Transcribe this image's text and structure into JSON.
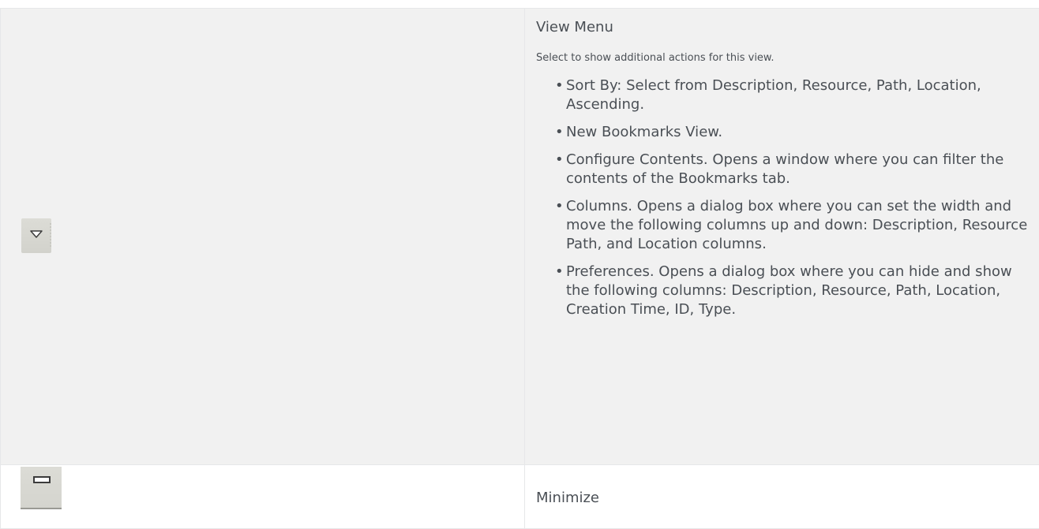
{
  "rows": [
    {
      "icon": "view-menu-triangle-icon",
      "title": "View Menu",
      "subtitle": "Select to show additional actions for this view.",
      "items": [
        "Sort By: Select from Description, Resource, Path, Location, Ascending.",
        "New Bookmarks View.",
        "Configure Contents. Opens a window where you can filter the contents of the Bookmarks tab.",
        "Columns. Opens a dialog box where you can set the width and move the following columns up and down: Description, Resource Path, and Location columns.",
        "Preferences. Opens a dialog box where you can hide and show the following columns: Description, Resource, Path, Location, Creation Time, ID, Type."
      ]
    },
    {
      "icon": "minimize-icon",
      "title": "Minimize"
    }
  ],
  "bullet": "•"
}
